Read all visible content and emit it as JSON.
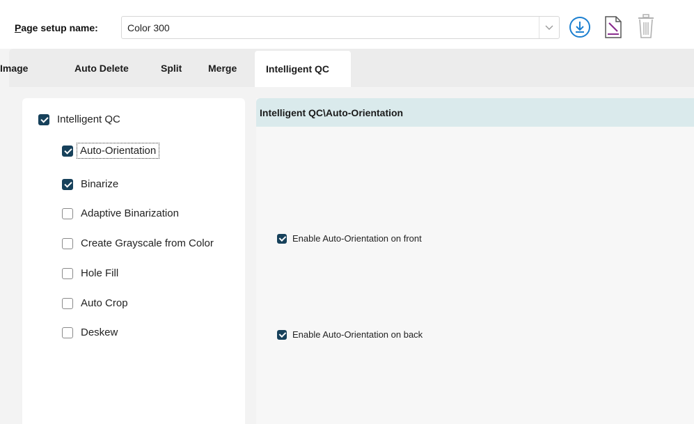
{
  "setup": {
    "label_first": "P",
    "label_rest": "age setup name:",
    "value": "Color 300"
  },
  "icons": {
    "dropdown": "chevron-down-icon",
    "save": "download-circle-icon",
    "edit": "edit-document-icon",
    "delete": "trash-icon"
  },
  "tabs": [
    {
      "label": "Image"
    },
    {
      "label": "Auto Delete"
    },
    {
      "label": "Split"
    },
    {
      "label": "Merge"
    },
    {
      "label": "Intelligent QC",
      "active": true
    }
  ],
  "tree": {
    "root": {
      "label": "Intelligent QC",
      "checked": true
    },
    "items": [
      {
        "label": "Auto-Orientation",
        "checked": true,
        "focused": true
      },
      {
        "label": "Binarize",
        "checked": true
      },
      {
        "label": "Adaptive Binarization",
        "checked": false
      },
      {
        "label": "Create Grayscale from Color",
        "checked": false
      },
      {
        "label": "Hole Fill",
        "checked": false
      },
      {
        "label": "Auto Crop",
        "checked": false
      },
      {
        "label": "Deskew",
        "checked": false
      }
    ]
  },
  "detail": {
    "title": "Intelligent QC\\Auto-Orientation",
    "options": [
      {
        "label": "Enable Auto-Orientation on front",
        "checked": true
      },
      {
        "label": "Enable Auto-Orientation on back",
        "checked": true
      }
    ]
  },
  "colors": {
    "checkbox": "#17415b",
    "header_bg": "#daeaec",
    "accent_blue": "#1b7fd0",
    "accent_purple": "#8a2d8e"
  }
}
